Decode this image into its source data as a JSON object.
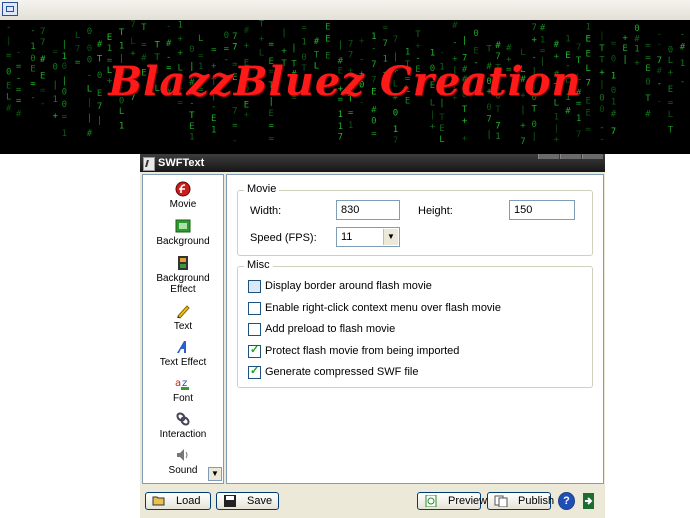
{
  "banner": {
    "title": "BlazzBluez Creation"
  },
  "dialog": {
    "title": "SWFText",
    "sidebar": {
      "items": [
        {
          "label": "Movie",
          "icon": "flash-icon"
        },
        {
          "label": "Background",
          "icon": "background-icon"
        },
        {
          "label": "Background Effect",
          "icon": "film-icon"
        },
        {
          "label": "Text",
          "icon": "pencil-icon"
        },
        {
          "label": "Text Effect",
          "icon": "text-effect-icon"
        },
        {
          "label": "Font",
          "icon": "font-icon"
        },
        {
          "label": "Interaction",
          "icon": "link-icon"
        },
        {
          "label": "Sound",
          "icon": "speaker-icon"
        }
      ]
    },
    "movie": {
      "legend": "Movie",
      "width_label": "Width:",
      "width_value": "830",
      "height_label": "Height:",
      "height_value": "150",
      "speed_label": "Speed (FPS):",
      "speed_value": "11"
    },
    "misc": {
      "legend": "Misc",
      "options": [
        {
          "label": "Display border around flash movie",
          "checked": false
        },
        {
          "label": "Enable right-click context menu over flash movie",
          "checked": false
        },
        {
          "label": "Add preload to flash movie",
          "checked": false
        },
        {
          "label": "Protect flash movie from being imported",
          "checked": true
        },
        {
          "label": "Generate compressed SWF file",
          "checked": true
        }
      ]
    },
    "buttons": {
      "load": "Load",
      "save": "Save",
      "preview": "Preview",
      "publish": "Publish",
      "help": "?"
    }
  },
  "colors": {
    "banner_text": "#ff1a1a",
    "matrix_green": "#22c22e",
    "titlebar": "#1e1e1e"
  }
}
